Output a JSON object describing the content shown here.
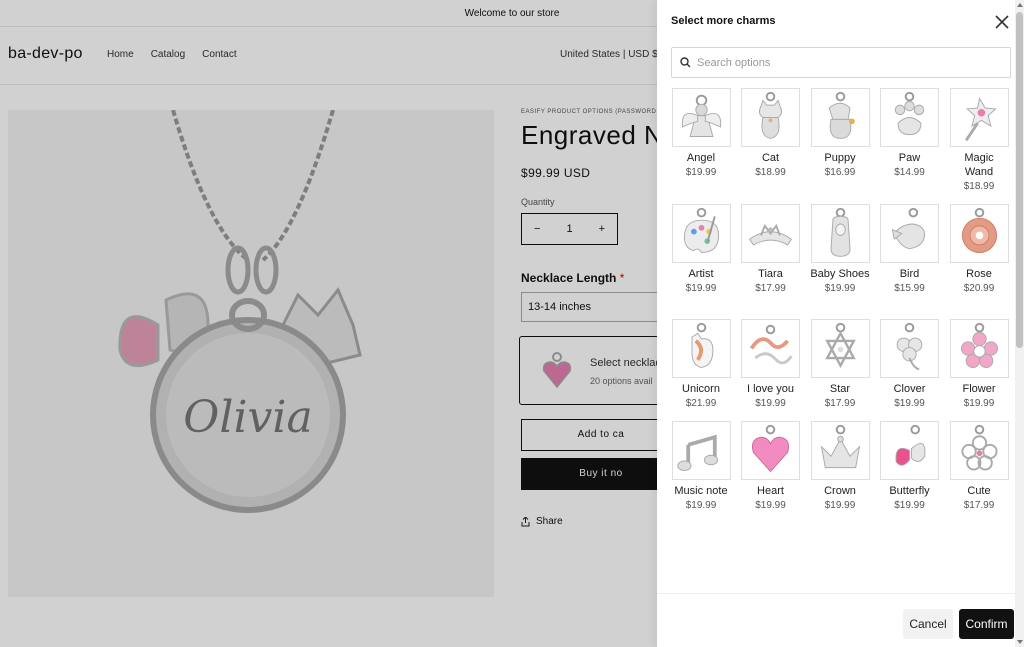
{
  "store": {
    "announcement": "Welcome to our store",
    "logo": "ba-dev-po",
    "nav": [
      "Home",
      "Catalog",
      "Contact"
    ],
    "locale": "United States | USD $"
  },
  "product": {
    "vendor": "EASIFY PRODUCT OPTIONS (PASSWORD",
    "title": "Engraved Ne",
    "price": "$99.99 USD",
    "quantity_label": "Quantity",
    "quantity": "1",
    "minus": "−",
    "plus": "+",
    "image_engraving": "Olivia",
    "option_label": "Necklace Length",
    "required_mark": "*",
    "option_value": "13-14 inches",
    "charm_select_title": "Select necklac",
    "charm_select_sub": "20 options avail",
    "add_to_cart": "Add to ca",
    "buy_now": "Buy it no",
    "share": "Share"
  },
  "modal": {
    "title": "Select more charms",
    "search_placeholder": "Search options",
    "cancel": "Cancel",
    "confirm": "Confirm",
    "charms": [
      {
        "name": "Angel",
        "price": "$19.99",
        "icon": "angel"
      },
      {
        "name": "Cat",
        "price": "$18.99",
        "icon": "cat"
      },
      {
        "name": "Puppy",
        "price": "$16.99",
        "icon": "puppy"
      },
      {
        "name": "Paw",
        "price": "$14.99",
        "icon": "paw"
      },
      {
        "name": "Magic Wand",
        "price": "$18.99",
        "icon": "wand"
      },
      {
        "name": "Artist",
        "price": "$19.99",
        "icon": "palette"
      },
      {
        "name": "Tiara",
        "price": "$17.99",
        "icon": "tiara"
      },
      {
        "name": "Baby Shoes",
        "price": "$19.99",
        "icon": "shoes"
      },
      {
        "name": "Bird",
        "price": "$15.99",
        "icon": "bird"
      },
      {
        "name": "Rose",
        "price": "$20.99",
        "icon": "rose"
      },
      {
        "name": "Unicorn",
        "price": "$21.99",
        "icon": "unicorn"
      },
      {
        "name": "I love you",
        "price": "$19.99",
        "icon": "love"
      },
      {
        "name": "Star",
        "price": "$17.99",
        "icon": "star"
      },
      {
        "name": "Clover",
        "price": "$19.99",
        "icon": "clover"
      },
      {
        "name": "Flower",
        "price": "$19.99",
        "icon": "flower"
      },
      {
        "name": "Music note",
        "price": "$19.99",
        "icon": "music"
      },
      {
        "name": "Heart",
        "price": "$19.99",
        "icon": "heart"
      },
      {
        "name": "Crown",
        "price": "$19.99",
        "icon": "crown"
      },
      {
        "name": "Butterfly",
        "price": "$19.99",
        "icon": "butterfly"
      },
      {
        "name": "Cute",
        "price": "$17.99",
        "icon": "cute"
      }
    ]
  },
  "colors": {
    "accent": "#121212",
    "pink": "#e97aa8",
    "silver": "#b9bcc0",
    "rose_gold": "#e59a83"
  }
}
